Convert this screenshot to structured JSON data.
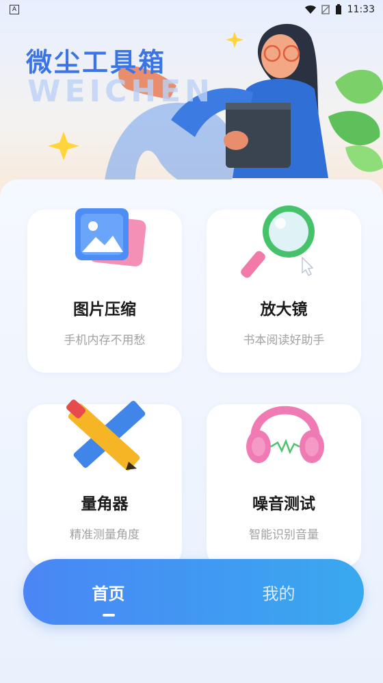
{
  "status_bar": {
    "time": "11:33"
  },
  "hero": {
    "title": "微尘工具箱",
    "subtitle": "WEICHEN"
  },
  "tools": [
    {
      "name": "图片压缩",
      "desc": "手机内存不用愁",
      "icon": "image-icon"
    },
    {
      "name": "放大镜",
      "desc": "书本阅读好助手",
      "icon": "magnifier-icon"
    },
    {
      "name": "量角器",
      "desc": "精准测量角度",
      "icon": "ruler-pencil-icon"
    },
    {
      "name": "噪音测试",
      "desc": "智能识别音量",
      "icon": "headphones-icon"
    }
  ],
  "nav": {
    "home": "首页",
    "mine": "我的",
    "active": "home"
  },
  "colors": {
    "accent": "#3a74e6",
    "nav_start": "#4a86f5",
    "nav_end": "#39a9ef"
  }
}
